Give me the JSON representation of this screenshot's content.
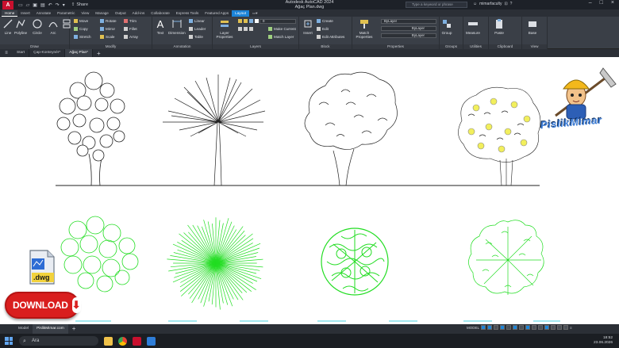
{
  "titlebar": {
    "app_letter": "A",
    "share_label": "Share",
    "app_name": "Autodesk AutoCAD 2024",
    "file_name": "Ağaç Plan.dwg",
    "search_placeholder": "Type a keyword or phrase",
    "username": "mimarfaculty"
  },
  "ribbon_tabs": [
    "Home",
    "Insert",
    "Annotate",
    "Parametric",
    "View",
    "Manage",
    "Output",
    "Add-ins",
    "Collaborate",
    "Express Tools",
    "Featured Apps",
    "Layout"
  ],
  "ribbon": {
    "draw": {
      "title": "Draw",
      "tools": [
        "Line",
        "Polyline",
        "Circle",
        "Arc"
      ]
    },
    "modify": {
      "title": "Modify",
      "tools": [
        "Move",
        "Rotate",
        "Trim",
        "Copy",
        "Mirror",
        "Fillet",
        "Stretch",
        "Scale",
        "Array"
      ]
    },
    "annotation": {
      "title": "Annotation",
      "tools": [
        "Text",
        "Dimension",
        "Linear",
        "Leader",
        "Table"
      ]
    },
    "layers": {
      "title": "Layers",
      "tools": [
        "Layer Properties",
        "Make Current",
        "Match Layer"
      ],
      "current_layer": "0"
    },
    "block": {
      "title": "Block",
      "tools": [
        "Insert",
        "Create",
        "Edit",
        "Edit Attributes"
      ]
    },
    "properties": {
      "title": "Properties",
      "tools": [
        "Match Properties"
      ],
      "color": "ByLayer",
      "linetype": "ByLayer",
      "lineweight": "ByLayer"
    },
    "groups": {
      "title": "Groups",
      "tools": [
        "Group"
      ]
    },
    "utilities": {
      "title": "Utilities",
      "tools": [
        "Measure"
      ]
    },
    "clipboard": {
      "title": "Clipboard",
      "tools": [
        "Paste"
      ]
    },
    "view": {
      "title": "View",
      "tools": [
        "Base"
      ]
    }
  },
  "doc_tabs": [
    "Start",
    "Çap-Konteynér*",
    "Ağaç Plan*"
  ],
  "layout_tabs": [
    "Model",
    "PislikMimar.com"
  ],
  "status": {
    "model_label": "MODEL"
  },
  "taskbar": {
    "search_label": "Ara",
    "time": "18:52",
    "date": "23.06.2026"
  },
  "overlays": {
    "download_label": "DOWNLOAD",
    "dwg_label": ".dwg",
    "brand_text": "PislikMimar"
  },
  "colors": {
    "accent": "#1c84d8",
    "plan_green": "#22dd22",
    "download_red": "#d91e1e"
  }
}
